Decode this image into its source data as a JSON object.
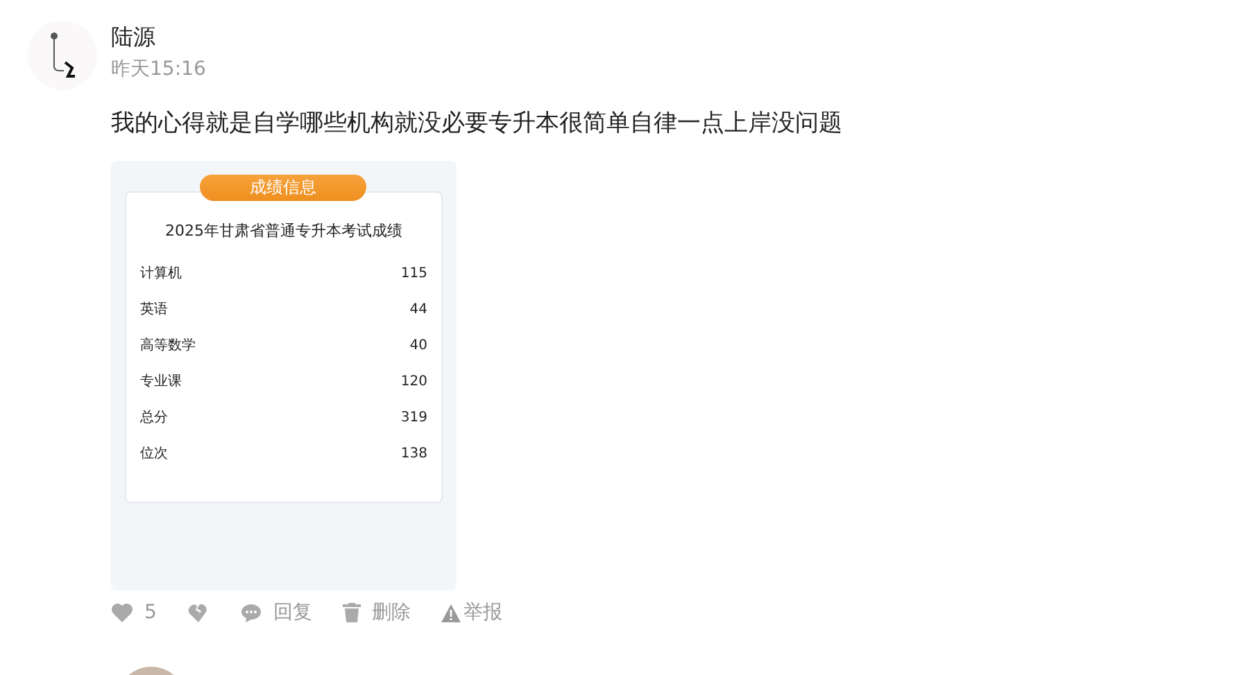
{
  "post": {
    "author": "陆源",
    "time": "昨天15:16",
    "text": "我的心得就是自学哪些机构就没必要专升本很简单自律一点上岸没问题",
    "image": {
      "badge": "成绩信息",
      "title": "2025年甘肃省普通专升本考试成绩",
      "rows": [
        {
          "label": "计算机",
          "value": "115"
        },
        {
          "label": "英语",
          "value": "44"
        },
        {
          "label": "高等数学",
          "value": "40"
        },
        {
          "label": "专业课",
          "value": "120"
        },
        {
          "label": "总分",
          "value": "319"
        },
        {
          "label": "位次",
          "value": "138"
        }
      ]
    },
    "actions": [
      {
        "kind": "like",
        "label": "5"
      },
      {
        "kind": "dislike"
      },
      {
        "kind": "reply",
        "label": "回复"
      },
      {
        "kind": "delete",
        "label": "删除"
      },
      {
        "kind": "report",
        "label": "举报"
      }
    ]
  }
}
